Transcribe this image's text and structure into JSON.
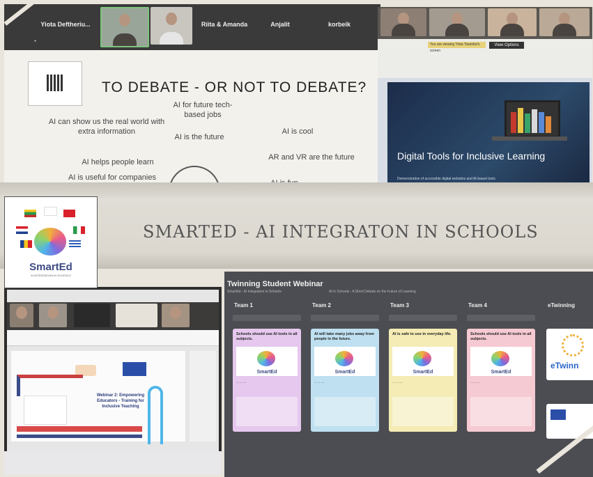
{
  "debate_panel": {
    "participants": [
      "Yiota Deftheriu...",
      "",
      "",
      "Riita & Amanda",
      "Anjalit",
      "korbeik"
    ],
    "slide_title": "TO DEBATE - OR NOT TO DEBATE?",
    "phrases": [
      "AI for future tech-based jobs",
      "AI can show us the real world with extra information",
      "AI is the future",
      "AI is cool",
      "AI helps people learn",
      "AR and VR are the future",
      "AI is useful for companies",
      "AI is fun"
    ]
  },
  "digital_tools_panel": {
    "banner_text": "You are viewing Yiota Tsiamitzi's screen",
    "view_options": "View Options",
    "slide_title": "Digital Tools for Inclusive Learning",
    "slide_subtitle": "Demonstration of accessible digital websites and AI-based tools"
  },
  "banner": {
    "title": "SMARTED - AI INTEGRATON IN SCHOOLS"
  },
  "logo": {
    "name": "SmartEd",
    "subtitle": "AI INTEGRATION IN SCHOOLS"
  },
  "webinar_panel": {
    "slide_title": "Webinar 2: Empowering Educators - Training for Inclusive Teaching"
  },
  "padlet": {
    "title": "Twinning Student Webinar",
    "subtitle": "SmartEd - AI Integration in Schools",
    "subtitle2": "AI in Schools - A Short Debate on the Future of Learning",
    "columns": [
      {
        "header": "Team 1",
        "card_title": "Schools should use AI tools in all subjects.",
        "color": "#e6c8ee"
      },
      {
        "header": "Team 2",
        "card_title": "AI will take many jobs away from people in the future.",
        "color": "#bfe0f0"
      },
      {
        "header": "Team 3",
        "card_title": "AI is safe to use in everyday life.",
        "color": "#f4ecb4"
      },
      {
        "header": "Team 4",
        "card_title": "Schools should use AI tools in all subjects.",
        "color": "#f6cad2"
      }
    ],
    "extra_column": "eTwinning",
    "card_logo": "SmartEd",
    "etwinning_logo": "eTwinn"
  }
}
